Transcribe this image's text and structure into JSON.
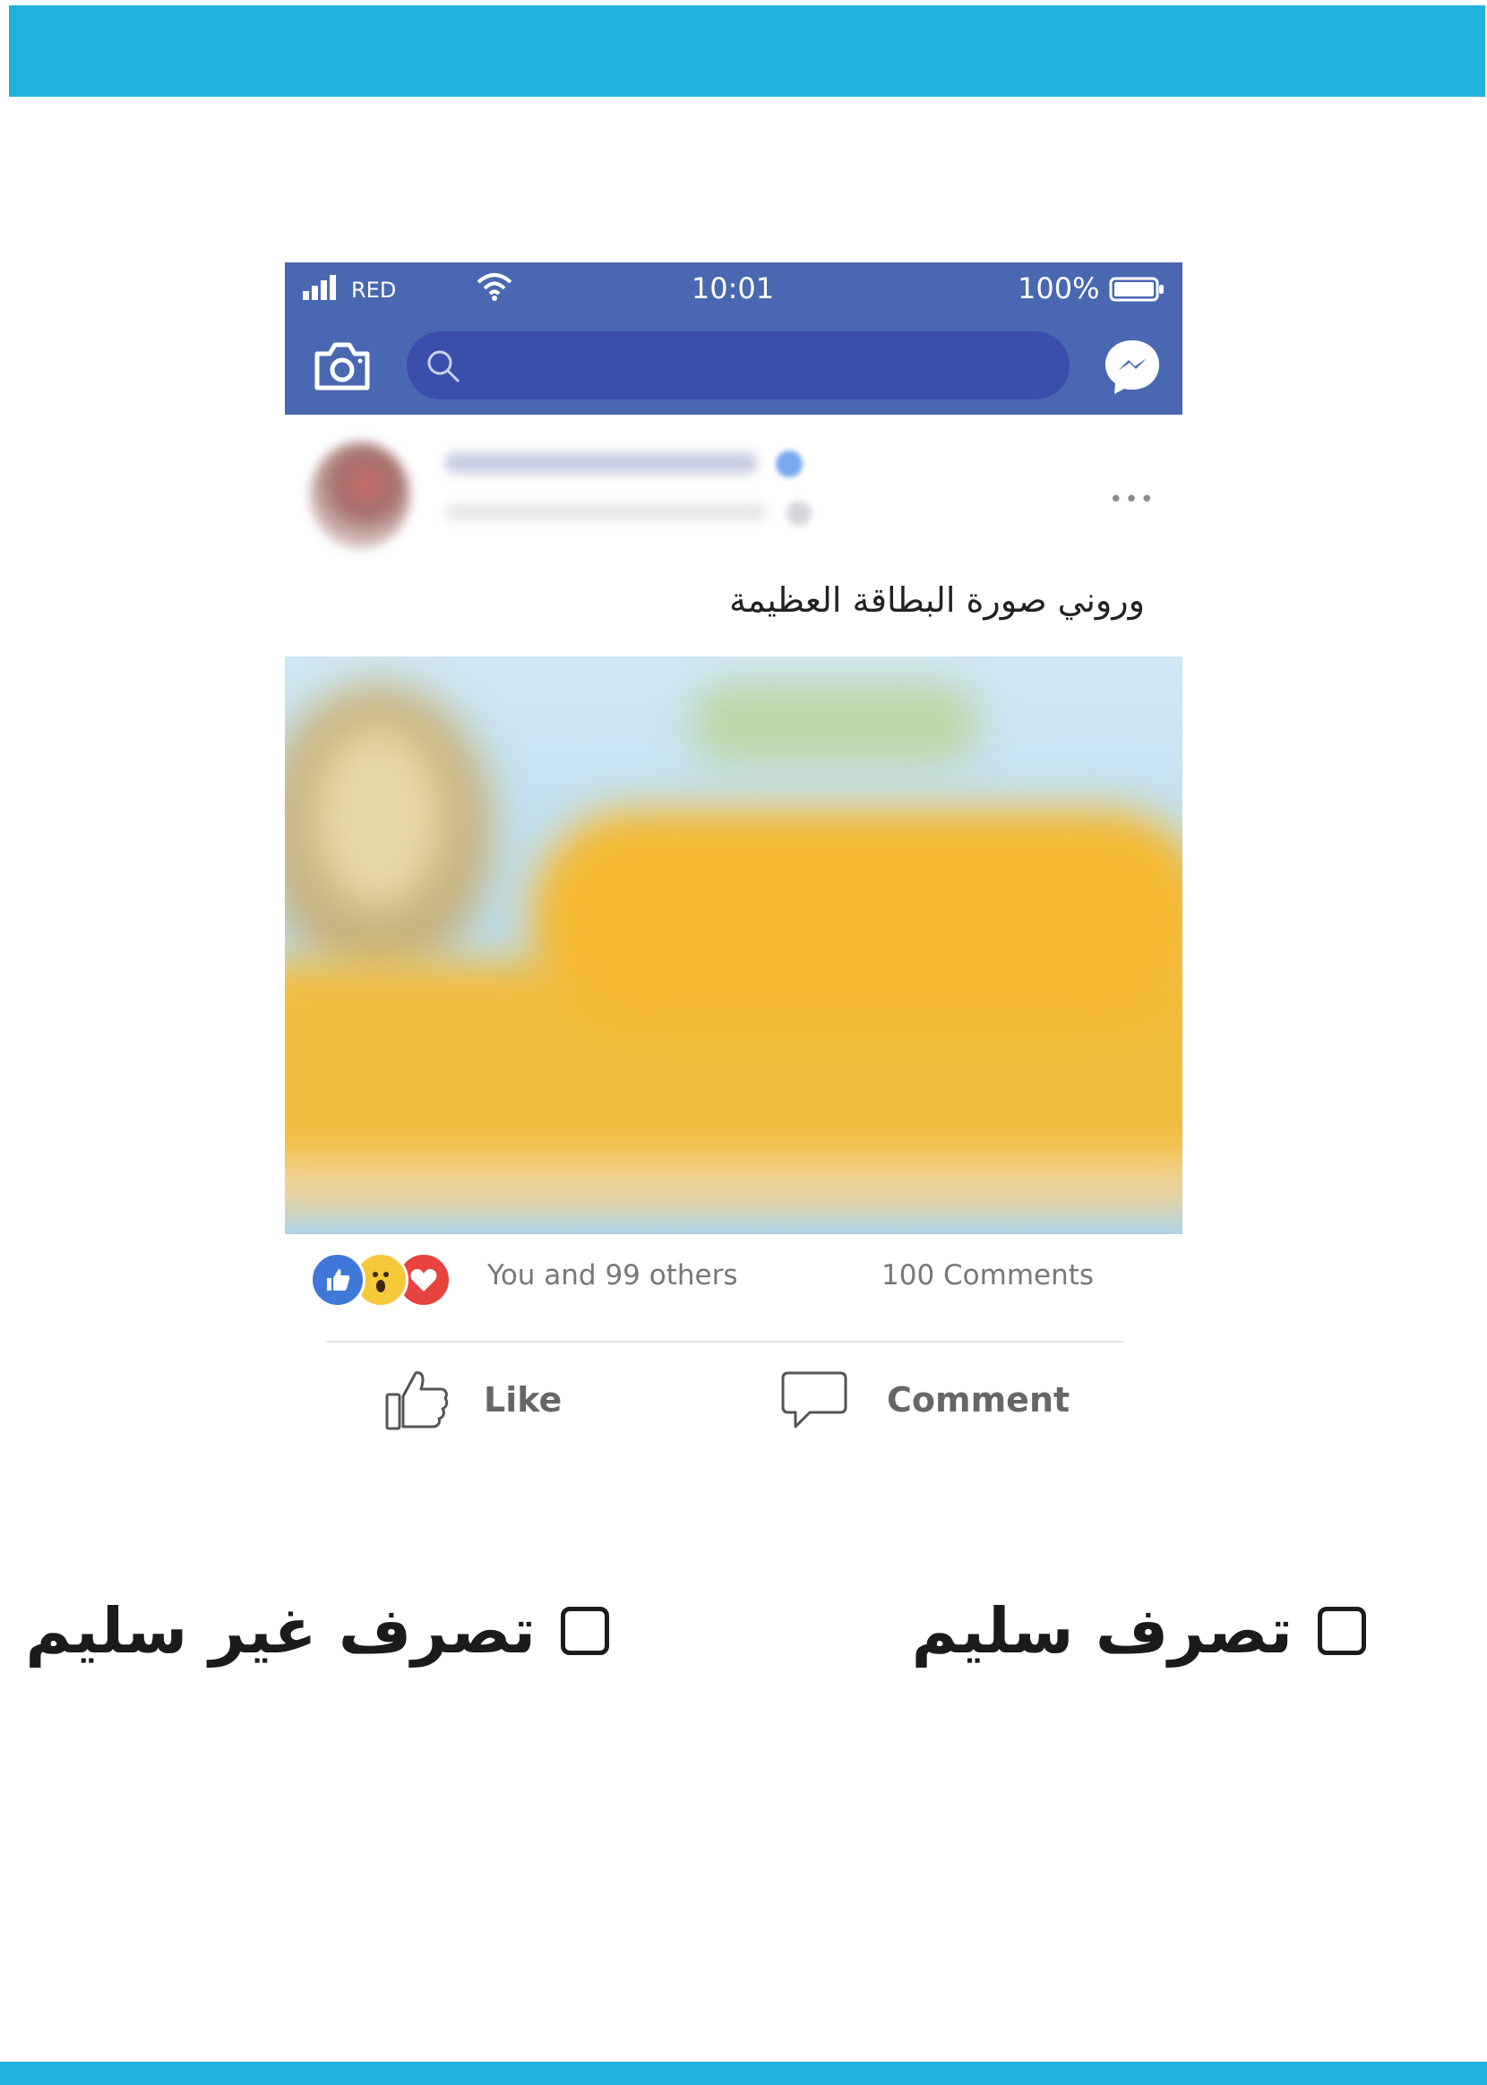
{
  "colors": {
    "accent_band": "#20b1dc",
    "facebook_blue": "#4a67b2",
    "search_bg": "#3a4eab"
  },
  "status_bar": {
    "carrier": "RED",
    "time": "10:01",
    "battery": "100%",
    "icons": [
      "signal-icon",
      "wifi-icon",
      "battery-icon"
    ]
  },
  "app_bar": {
    "icons": [
      "camera-icon",
      "search-icon",
      "messenger-icon"
    ],
    "search_placeholder": ""
  },
  "post": {
    "text": "وروني صورة البطاقة العظيمة",
    "more_icon": "•••",
    "reactions": [
      "like",
      "wow",
      "love"
    ],
    "reactions_text": "You and 99 others",
    "comments_count": "100 Comments",
    "like_label": "Like",
    "comment_label": "Comment"
  },
  "options": [
    {
      "label": "تصرف سليم",
      "checked": false
    },
    {
      "label": "تصرف غير سليم",
      "checked": false
    }
  ]
}
